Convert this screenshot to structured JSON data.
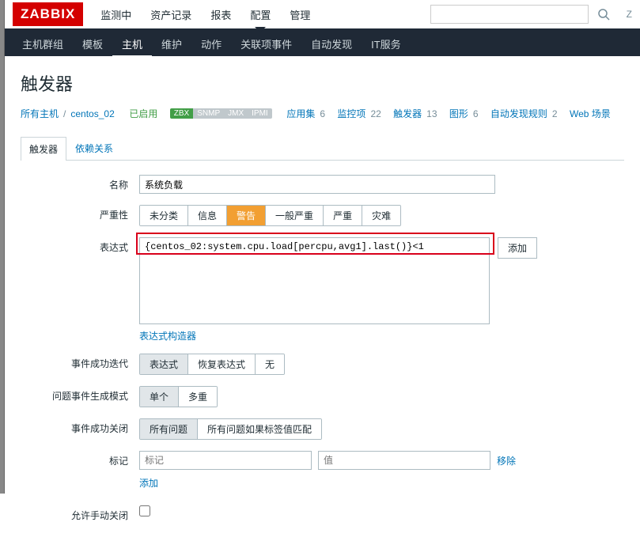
{
  "logo": "ZABBIX",
  "top_menu": {
    "items": [
      "监测中",
      "资产记录",
      "报表",
      "配置",
      "管理"
    ],
    "active_index": 3
  },
  "search": {
    "placeholder": ""
  },
  "z_text": "Z",
  "sub_nav": {
    "items": [
      "主机群组",
      "模板",
      "主机",
      "维护",
      "动作",
      "关联项事件",
      "自动发现",
      "IT服务"
    ],
    "active_index": 2
  },
  "page_title": "触发器",
  "breadcrumb": {
    "all_hosts": "所有主机",
    "host": "centos_02",
    "enabled": "已启用",
    "tags": {
      "zbx": "ZBX",
      "snmp": "SNMP",
      "jmx": "JMX",
      "ipmi": "IPMI"
    },
    "links": [
      {
        "label": "应用集",
        "count": "6"
      },
      {
        "label": "监控项",
        "count": "22"
      },
      {
        "label": "触发器",
        "count": "13"
      },
      {
        "label": "图形",
        "count": "6"
      },
      {
        "label": "自动发现规则",
        "count": "2"
      },
      {
        "label": "Web 场景",
        "count": ""
      }
    ]
  },
  "tabs": {
    "trigger": "触发器",
    "dependencies": "依赖关系"
  },
  "form": {
    "name_label": "名称",
    "name_value": "系统负载",
    "severity_label": "严重性",
    "severity_options": [
      "未分类",
      "信息",
      "警告",
      "一般严重",
      "严重",
      "灾难"
    ],
    "severity_selected_index": 2,
    "expression_label": "表达式",
    "expression_value": "{centos_02:system.cpu.load[percpu,avg1].last()}<1",
    "add_button": "添加",
    "expression_builder": "表达式构造器",
    "event_gen_label": "事件成功迭代",
    "event_gen_options": [
      "表达式",
      "恢复表达式",
      "无"
    ],
    "problem_mode_label": "问题事件生成模式",
    "problem_mode_options": [
      "单个",
      "多重"
    ],
    "ok_close_label": "事件成功关闭",
    "ok_close_options": [
      "所有问题",
      "所有问题如果标签值匹配"
    ],
    "tags_label": "标记",
    "tag_name_placeholder": "标记",
    "tag_value_placeholder": "值",
    "remove_link": "移除",
    "add_link": "添加",
    "manual_close_label": "允许手动关闭"
  }
}
